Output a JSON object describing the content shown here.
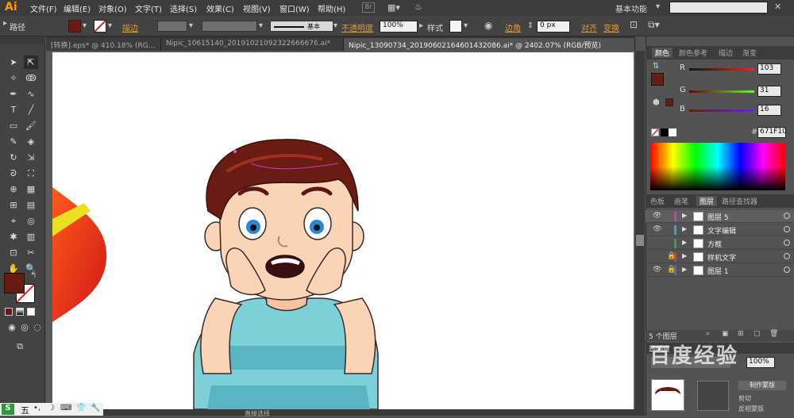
{
  "app": {
    "logo": "Ai"
  },
  "menu": [
    "文件(F)",
    "编辑(E)",
    "对象(O)",
    "文字(T)",
    "选择(S)",
    "效果(C)",
    "视图(V)",
    "窗口(W)",
    "帮助(H)"
  ],
  "workspace": "基本功能",
  "control": {
    "mode_label": "路径",
    "stroke_label": "描边",
    "stroke_style": "基本",
    "opacity_label": "不透明度",
    "opacity_value": "100%",
    "style_label": "样式",
    "corner_label": "边角",
    "corner_value": "0 px",
    "align_label": "对齐",
    "transform_label": "变换",
    "fill_color": "#6a1a10"
  },
  "tabs": [
    "[转换].eps* @ 410.18% (RG...",
    "Nipic_10615140_20191021092322666676.ai*",
    "Nipic_13090734_20190602164601432086.ai* @ 2402.07% (RGB/预览)"
  ],
  "color_panel": {
    "tabs": [
      "颜色",
      "颜色参考",
      "描边",
      "渐变"
    ],
    "r_label": "R",
    "g_label": "G",
    "b_label": "B",
    "r": "103",
    "g": "31",
    "b": "16",
    "hex_symbol": "#",
    "hex": "671F10"
  },
  "layers_panel": {
    "tabs": [
      "色板",
      "画笔",
      "图层",
      "路径查找器"
    ],
    "layers": [
      {
        "name": "图层 5",
        "color": "#c040c0",
        "visible": true,
        "locked": false
      },
      {
        "name": "文字编辑",
        "color": "#3aa0d0",
        "visible": true,
        "locked": false
      },
      {
        "name": "方框",
        "color": "#30a060",
        "visible": false,
        "locked": false
      },
      {
        "name": "样机文字",
        "color": "#d04040",
        "visible": false,
        "locked": true
      },
      {
        "name": "图层 1",
        "color": "#4070d0",
        "visible": true,
        "locked": true
      }
    ],
    "footer": "5 个图层"
  },
  "bottom_panel": {
    "tab": "透明度",
    "value": "100%",
    "btn1": "制作蒙版",
    "btn2": "剪切",
    "btn3": "反相蒙版"
  },
  "status": {
    "label": "直接选择"
  },
  "taskbar": {
    "ime": "五"
  },
  "watermark": "百度经验"
}
